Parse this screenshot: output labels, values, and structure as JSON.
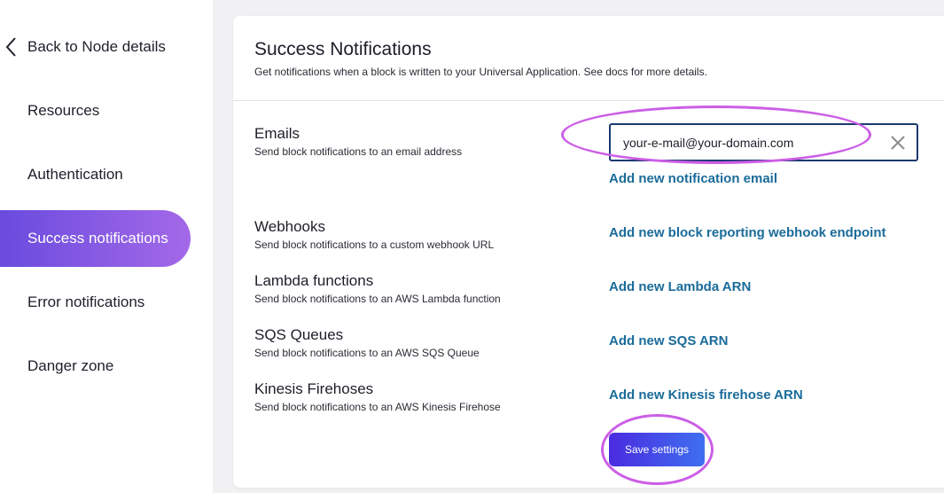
{
  "sidebar": {
    "back_label": "Back to Node details",
    "items": [
      {
        "label": "Resources"
      },
      {
        "label": "Authentication"
      },
      {
        "label": "Success notifications"
      },
      {
        "label": "Error notifications"
      },
      {
        "label": "Danger zone"
      }
    ]
  },
  "card": {
    "title": "Success Notifications",
    "subtitle": "Get notifications when a block is written to your Universal Application. See docs for more details.",
    "sections": [
      {
        "title": "Emails",
        "desc": "Send block notifications to an email address",
        "action": "Add new notification email"
      },
      {
        "title": "Webhooks",
        "desc": "Send block notifications to a custom webhook URL",
        "action": "Add new block reporting webhook endpoint"
      },
      {
        "title": "Lambda functions",
        "desc": "Send block notifications to an AWS Lambda function",
        "action": "Add new Lambda ARN"
      },
      {
        "title": "SQS Queues",
        "desc": "Send block notifications to an AWS SQS Queue",
        "action": "Add new SQS ARN"
      },
      {
        "title": "Kinesis Firehoses",
        "desc": "Send block notifications to an AWS Kinesis Firehose",
        "action": "Add new Kinesis firehose ARN"
      }
    ],
    "email_value": "your-e-mail@your-domain.com",
    "save_label": "Save settings"
  },
  "colors": {
    "accent": "#6a4bde",
    "link": "#1a6b9a",
    "highlight": "#cc5ee6",
    "input_border": "#1a3a6e"
  },
  "icons": {
    "back": "chevron-left-icon",
    "clear": "close-icon"
  }
}
